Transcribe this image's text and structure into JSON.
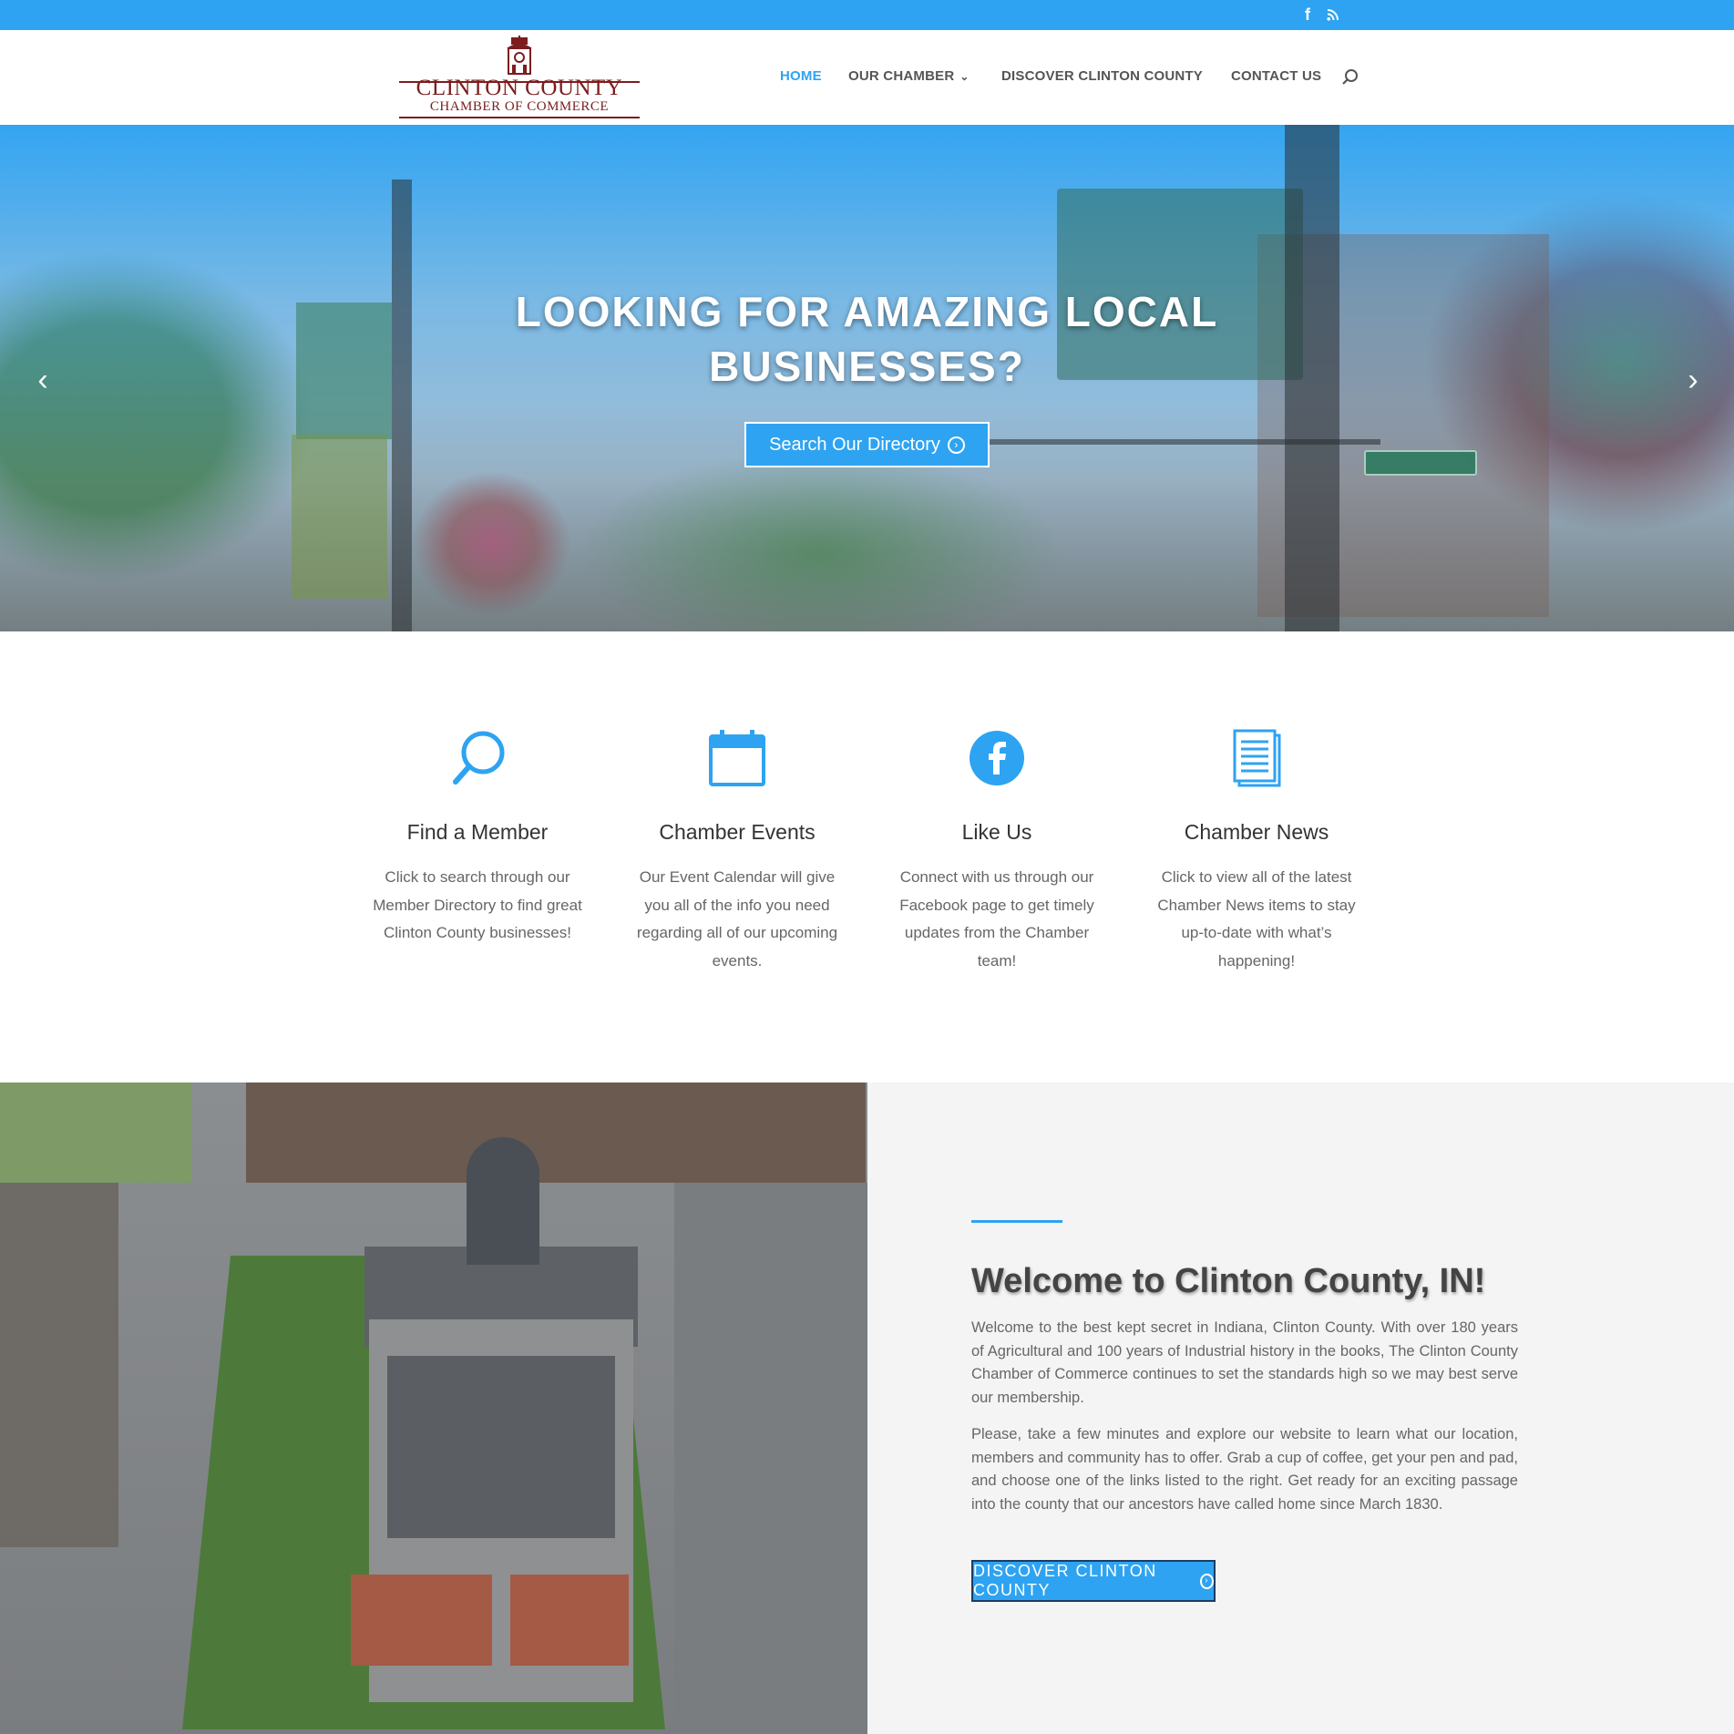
{
  "topbar": {
    "facebook_glyph": "f",
    "icons": [
      "facebook-icon",
      "rss-icon"
    ]
  },
  "header": {
    "logo": {
      "line1": "CLINTON COUNTY",
      "line2": "CHAMBER OF COMMERCE"
    },
    "nav": [
      {
        "label": "HOME",
        "active": true
      },
      {
        "label": "OUR CHAMBER",
        "dropdown": true
      },
      {
        "label": "DISCOVER CLINTON COUNTY"
      },
      {
        "label": "CONTACT US"
      }
    ],
    "chevron": "⌄"
  },
  "hero": {
    "title": "LOOKING FOR AMAZING LOCAL BUSINESSES?",
    "button_label": "Search Our Directory",
    "arrow_prev": "‹",
    "arrow_next": "›"
  },
  "features": [
    {
      "icon": "search-icon",
      "title": "Find a Member",
      "text": "Click to search through our Member Directory to find great Clinton County businesses!"
    },
    {
      "icon": "calendar-icon",
      "title": "Chamber Events",
      "text": "Our Event Calendar will give you all of the info you need regarding all of our upcoming events."
    },
    {
      "icon": "facebook-icon",
      "title": "Like Us",
      "text": "Connect with us through our Facebook page to get timely updates from the Chamber team!"
    },
    {
      "icon": "news-icon",
      "title": "Chamber News",
      "text": "Click to view all of the latest Chamber News items to stay up-to-date with what’s happening!"
    }
  ],
  "about": {
    "title": "Welcome to Clinton County, IN!",
    "p1": "Welcome to the best kept secret in Indiana, Clinton County.  With over 180 years of Agricultural and 100 years of Industrial history in the books, The Clinton County Chamber of Commerce continues to set the standards high so we may best serve our membership.",
    "p2": "Please, take a few minutes and explore our website to learn what our location, members and community has to offer.  Grab a cup of coffee, get your pen and pad, and choose one of the links listed to the right.  Get ready for an exciting passage into the county that our ancestors have called home since March 1830.",
    "button_label": "DISCOVER CLINTON COUNTY"
  },
  "colors": {
    "accent": "#2ea3f2",
    "logo": "#7b1e1e",
    "button_border": "#1b3c66",
    "panel": "#f4f4f4"
  }
}
